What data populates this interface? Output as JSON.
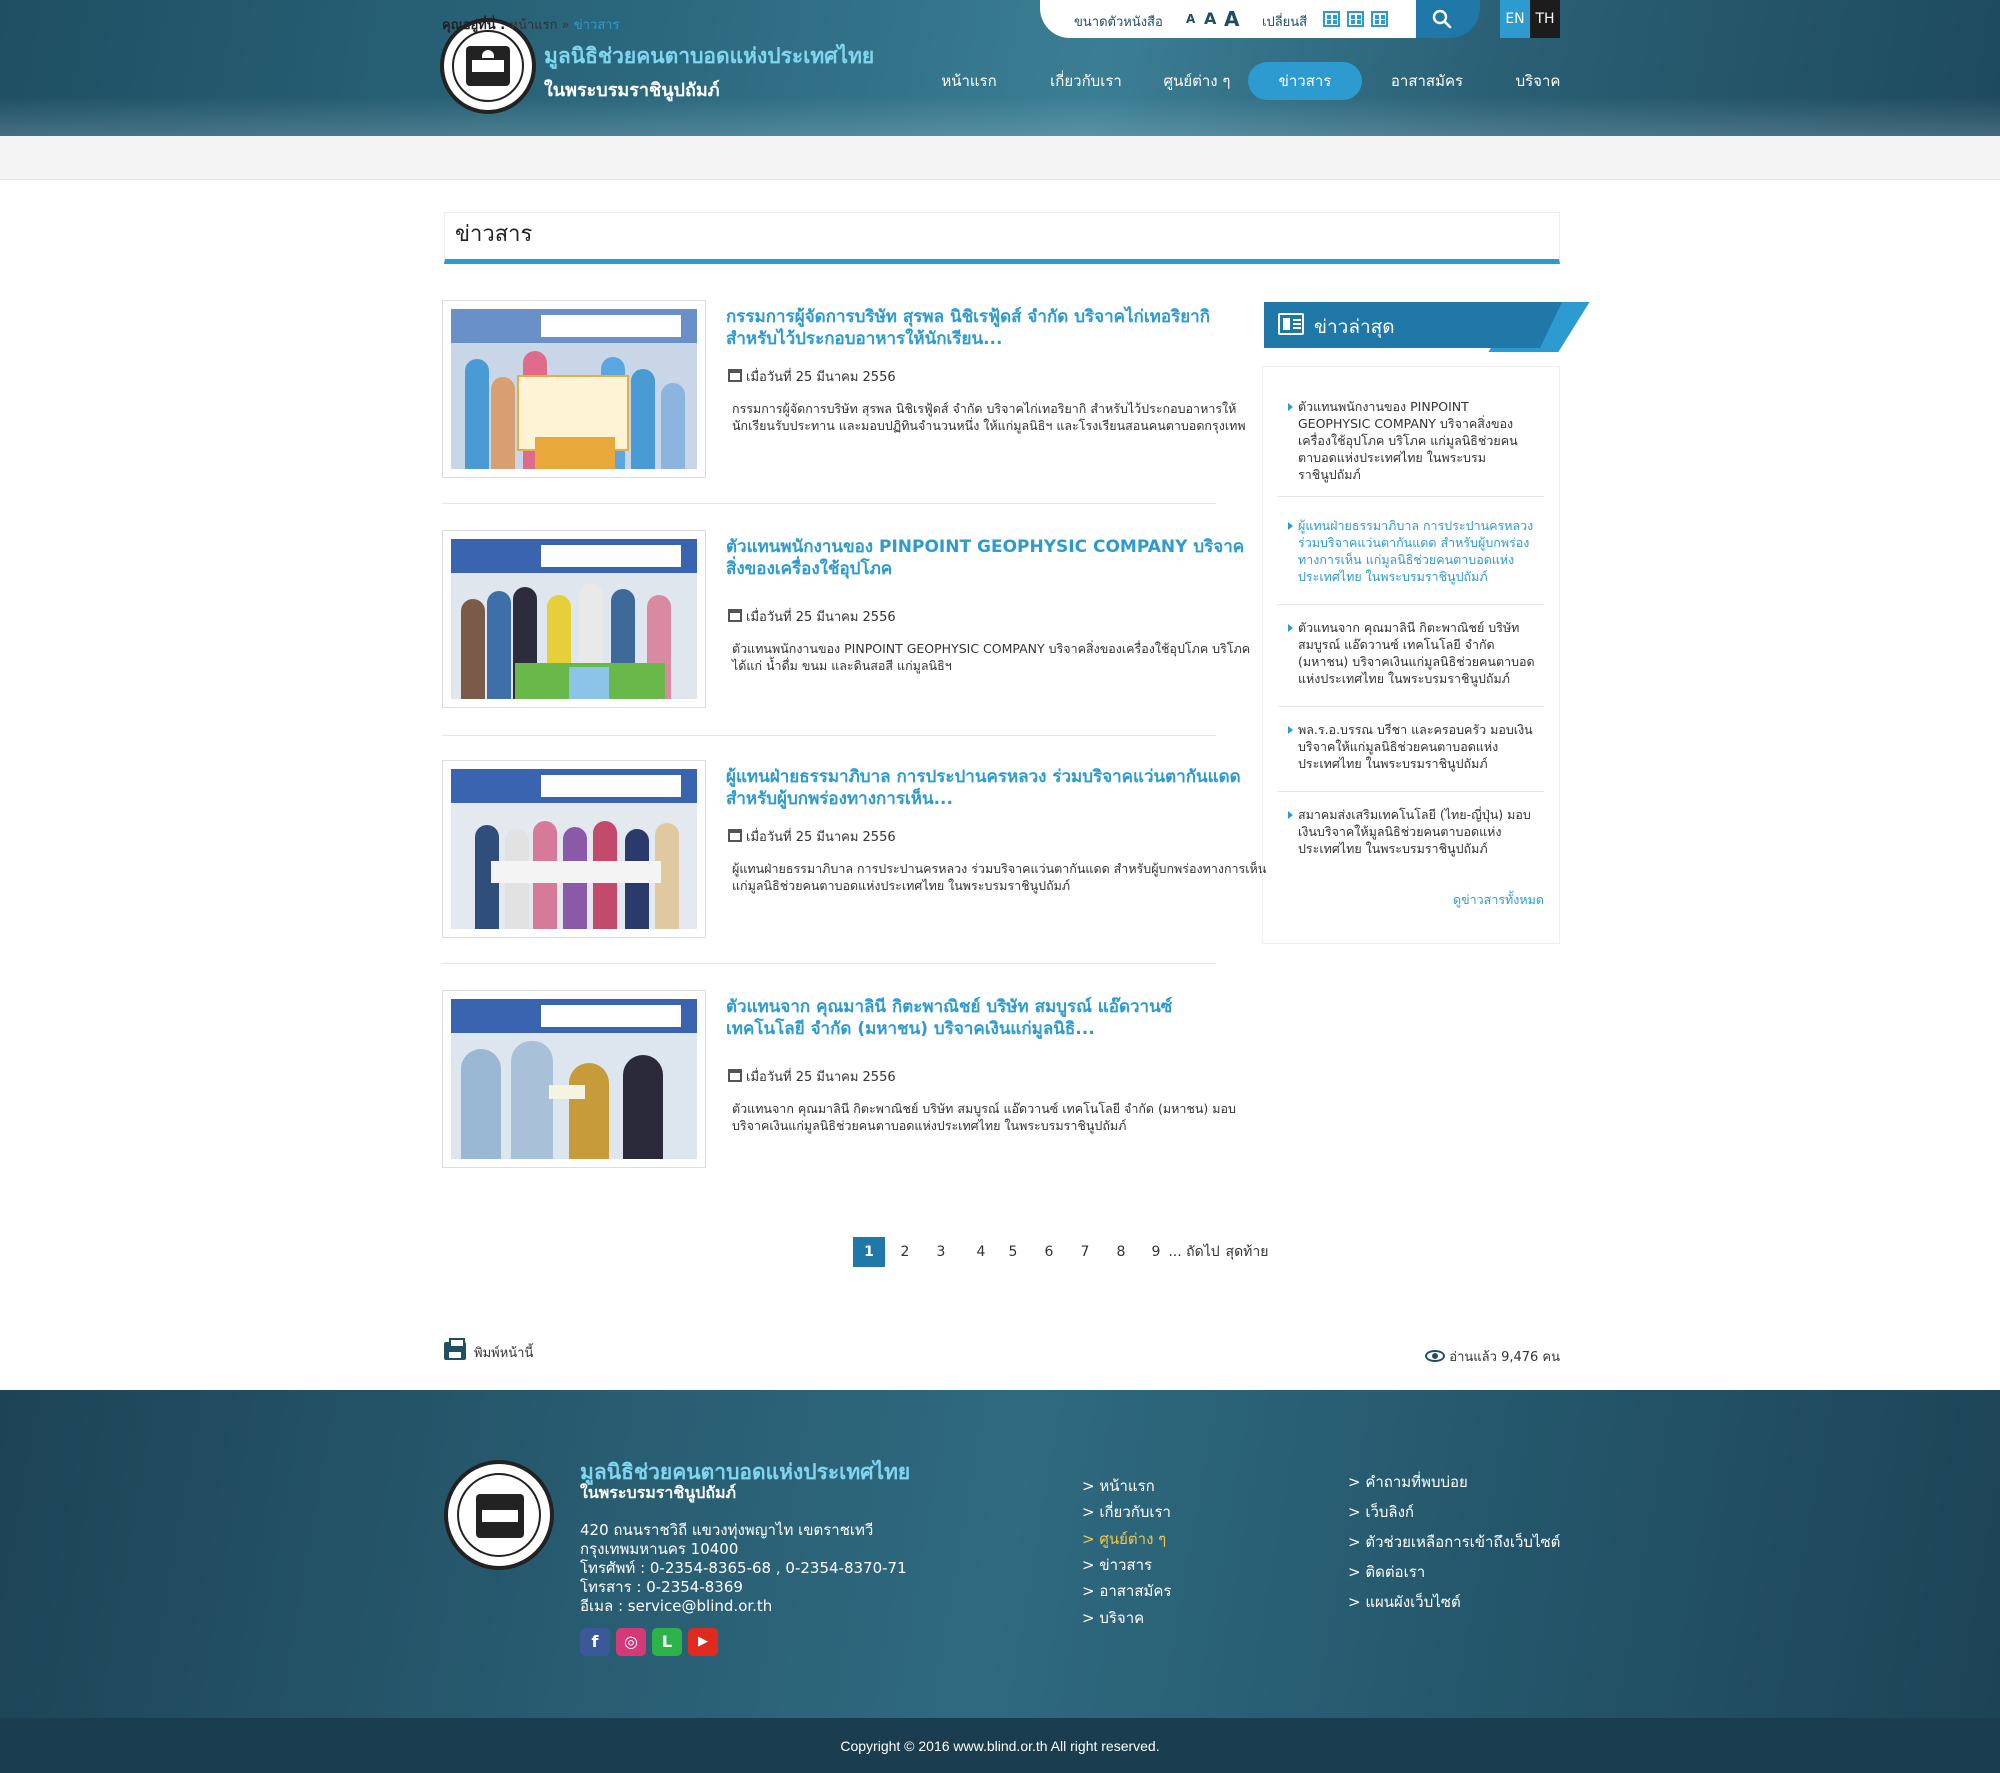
{
  "header": {
    "site_title_line1": "มูลนิธิช่วยคนตาบอดแห่งประเทศไทย",
    "site_title_line2": "ในพระบรมราชินูปถัมภ์",
    "font_size_label": "ขนาดตัวหนังสือ",
    "font_size_options": [
      "A",
      "A",
      "A"
    ],
    "color_label": "เปลี่ยนสี",
    "lang_en": "EN",
    "lang_th": "TH",
    "nav": [
      {
        "label": "หน้าแรก",
        "active": false
      },
      {
        "label": "เกี่ยวกับเรา",
        "active": false
      },
      {
        "label": "ศูนย์ต่าง ๆ",
        "active": false
      },
      {
        "label": "ข่าวสาร",
        "active": true
      },
      {
        "label": "อาสาสมัคร",
        "active": false
      },
      {
        "label": "บริจาค",
        "active": false
      }
    ]
  },
  "breadcrumb": {
    "label": "คุณอยู่ที่นี่ :",
    "home": "หน้าแรก",
    "sep": "»",
    "current": "ข่าวสาร"
  },
  "page_title": "ข่าวสาร",
  "news": [
    {
      "title": "กรรมการผู้จัดการบริษัท สุรพล นิชิเรฟู้ดส์ จำกัด บริจาคไก่เทอริยากิ สำหรับไว้ประกอบอาหารให้นักเรียน...",
      "date": "เมื่อวันที่ 25 มีนาคม 2556",
      "desc": "กรรมการผู้จัดการบริษัท สุรพล นิชิเรฟู้ดส์ จำกัด บริจาคไก่เทอริยากิ สำหรับไว้ประกอบอาหารให้นักเรียนรับประทาน และมอบปฏิทินจำนวนหนึ่ง ให้แก่มูลนิธิฯ และโรงเรียนสอนคนตาบอดกรุงเทพ"
    },
    {
      "title": "ตัวแทนพนักงานของ PINPOINT GEOPHYSIC COMPANY บริจาคสิ่งของเครื่องใช้อุปโภค",
      "date": "เมื่อวันที่ 25 มีนาคม 2556",
      "desc": "ตัวแทนพนักงานของ PINPOINT GEOPHYSIC COMPANY บริจาคสิ่งของเครื่องใช้อุปโภค บริโภค ได้แก่ น้ำดื่ม ขนม และดินสอสี แก่มูลนิธิฯ"
    },
    {
      "title": "ผู้แทนฝ่ายธรรมาภิบาล การประปานครหลวง ร่วมบริจาคแว่นตากันแดด สำหรับผู้บกพร่องทางการเห็น...",
      "date": "เมื่อวันที่ 25 มีนาคม 2556",
      "desc": "ผู้แทนฝ่ายธรรมาภิบาล การประปานครหลวง ร่วมบริจาคแว่นตากันแดด สำหรับผู้บกพร่องทางการเห็น แก่มูลนิธิช่วยคนตาบอดแห่งประเทศไทย ในพระบรมราชินูปถัมภ์"
    },
    {
      "title": "ตัวแทนจาก คุณมาลินี กิตะพาณิชย์ บริษัท สมบูรณ์ แอ๊ดวานซ์ เทคโนโลยี จำกัด (มหาชน) บริจาคเงินแก่มูลนิธิ...",
      "date": "เมื่อวันที่ 25 มีนาคม 2556",
      "desc": "ตัวแทนจาก คุณมาลินี กิตะพาณิชย์ บริษัท สมบูรณ์ แอ๊ดวานซ์ เทคโนโลยี จำกัด (มหาชน) มอบบริจาคเงินแก่มูลนิธิช่วยคนตาบอดแห่งประเทศไทย ในพระบรมราชินูปถัมภ์"
    }
  ],
  "sidebar": {
    "title": "ข่าวล่าสุด",
    "items": [
      "ตัวแทนพนักงานของ PINPOINT GEOPHYSIC COMPANY บริจาคสิ่งของเครื่องใช้อุปโภค บริโภค แก่มูลนิธิช่วยคนตาบอดแห่งประเทศไทย ในพระบรมราชินูปถัมภ์",
      "ผู้แทนฝ่ายธรรมาภิบาล การประปานครหลวง ร่วมบริจาคแว่นตากันแดด สำหรับผู้บกพร่องทางการเห็น แก่มูลนิธิช่วยคนตาบอดแห่งประเทศไทย ในพระบรมราชินูปถัมภ์",
      "ตัวแทนจาก คุณมาลินี กิตะพาณิชย์ บริษัท สมบูรณ์ แอ๊ดวานซ์ เทคโนโลยี จำกัด (มหาชน) บริจาคเงินแก่มูลนิธิช่วยคนตาบอดแห่งประเทศไทย ในพระบรมราชินูปถัมภ์",
      "พล.ร.อ.บรรณ บรีชา และครอบครัว มอบเงินบริจาคให้แก่มูลนิธิช่วยคนตาบอดแห่งประเทศไทย ในพระบรมราชินูปถัมภ์",
      "สมาคมส่งเสริมเทคโนโลยี (ไทย-ญี่ปุ่น) มอบเงินบริจาคให้มูลนิธิช่วยคนตาบอดแห่งประเทศไทย ในพระบรมราชินูปถัมภ์"
    ],
    "view_all": "ดูข่าวสารทั้งหมด"
  },
  "pagination": {
    "pages": [
      "1",
      "2",
      "3",
      "4",
      "5",
      "6",
      "7",
      "8",
      "9"
    ],
    "current": "1",
    "ellipsis_next": "... ถัดไป",
    "last": "สุดท้าย"
  },
  "print_label": "พิมพ์หน้านี้",
  "views_label": "อ่านแล้ว 9,476 คน",
  "footer": {
    "title_line1": "มูลนิธิช่วยคนตาบอดแห่งประเทศไทย",
    "title_line2": "ในพระบรมราชินูปถัมภ์",
    "address": [
      "420 ถนนราชวิถี แขวงทุ่งพญาไท เขตราชเทวี",
      "กรุงเทพมหานคร 10400",
      "โทรศัพท์ : 0-2354-8365-68 , 0-2354-8370-71",
      "โทรสาร : 0-2354-8369",
      "อีเมล : service@blind.or.th"
    ],
    "social": [
      {
        "name": "facebook-icon",
        "glyph": "f",
        "color": "#3b5998"
      },
      {
        "name": "instagram-icon",
        "glyph": "◎",
        "color": "#d6397a"
      },
      {
        "name": "line-icon",
        "glyph": "L",
        "color": "#2db34a"
      },
      {
        "name": "youtube-icon",
        "glyph": "▶",
        "color": "#e02a20"
      }
    ],
    "links_col1": [
      {
        "label": "> หน้าแรก",
        "highlight": false
      },
      {
        "label": "> เกี่ยวกับเรา",
        "highlight": false
      },
      {
        "label": "> ศูนย์ต่าง ๆ",
        "highlight": true
      },
      {
        "label": "> ข่าวสาร",
        "highlight": false
      },
      {
        "label": "> อาสาสมัคร",
        "highlight": false
      },
      {
        "label": "> บริจาค",
        "highlight": false
      }
    ],
    "links_col2": [
      "> คำถามที่พบบ่อย",
      "> เว็บลิงก์",
      "> ตัวช่วยเหลือการเข้าถึงเว็บไซต์",
      "> ติดต่อเรา",
      "> แผนผังเว็บไซต์"
    ],
    "copyright": "Copyright © 2016 www.blind.or.th All right reserved."
  },
  "colors": {
    "accent": "#2e9bd0",
    "dark_teal": "#1f4f63",
    "footer_highlight": "#f6c945"
  }
}
